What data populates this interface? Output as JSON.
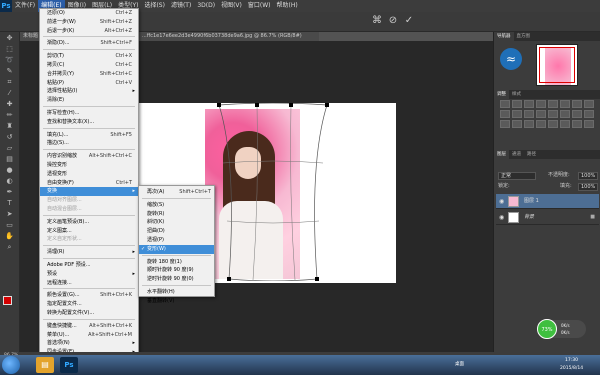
{
  "menubar": {
    "logo": "Ps",
    "items": [
      "文件(F)",
      "编辑(E)",
      "图像(I)",
      "图层(L)",
      "类型(Y)",
      "选择(S)",
      "滤镜(T)",
      "3D(D)",
      "视图(V)",
      "窗口(W)",
      "帮助(H)"
    ],
    "active_index": 1
  },
  "doc_tabs": [
    "未标题",
    "...ffc1e17e6ee2d3e4990f6b03738de9a6.jpg @ 86.7% (RGB/8#)"
  ],
  "edit_menu": {
    "items": [
      {
        "label": "还原(O)",
        "shortcut": "Ctrl+Z"
      },
      {
        "label": "前进一步(W)",
        "shortcut": "Shift+Ctrl+Z"
      },
      {
        "label": "后退一步(K)",
        "shortcut": "Alt+Ctrl+Z"
      },
      {
        "sep": true
      },
      {
        "label": "渐隐(D)...",
        "shortcut": "Shift+Ctrl+F"
      },
      {
        "sep": true
      },
      {
        "label": "剪切(T)",
        "shortcut": "Ctrl+X"
      },
      {
        "label": "拷贝(C)",
        "shortcut": "Ctrl+C"
      },
      {
        "label": "合并拷贝(Y)",
        "shortcut": "Shift+Ctrl+C"
      },
      {
        "label": "粘贴(P)",
        "shortcut": "Ctrl+V"
      },
      {
        "label": "选择性粘贴(I)",
        "shortcut": "",
        "submenu": true
      },
      {
        "label": "清除(E)",
        "shortcut": ""
      },
      {
        "sep": true
      },
      {
        "label": "拼写检查(H)...",
        "shortcut": ""
      },
      {
        "label": "查找和替换文本(X)...",
        "shortcut": ""
      },
      {
        "sep": true
      },
      {
        "label": "填充(L)...",
        "shortcut": "Shift+F5"
      },
      {
        "label": "描边(S)...",
        "shortcut": ""
      },
      {
        "sep": true
      },
      {
        "label": "内容识别缩放",
        "shortcut": "Alt+Shift+Ctrl+C"
      },
      {
        "label": "操控变形",
        "shortcut": ""
      },
      {
        "label": "透视变形",
        "shortcut": ""
      },
      {
        "label": "自由变换(F)",
        "shortcut": "Ctrl+T"
      },
      {
        "label": "变换",
        "shortcut": "",
        "submenu": true,
        "highlight": true
      },
      {
        "label": "自动对齐图层...",
        "shortcut": "",
        "disabled": true
      },
      {
        "label": "自动混合图层...",
        "shortcut": "",
        "disabled": true
      },
      {
        "sep": true
      },
      {
        "label": "定义画笔预设(B)...",
        "shortcut": ""
      },
      {
        "label": "定义图案...",
        "shortcut": ""
      },
      {
        "label": "定义自定形状...",
        "shortcut": "",
        "disabled": true
      },
      {
        "sep": true
      },
      {
        "label": "清理(R)",
        "shortcut": "",
        "submenu": true
      },
      {
        "sep": true
      },
      {
        "label": "Adobe PDF 预设...",
        "shortcut": ""
      },
      {
        "label": "预设",
        "shortcut": "",
        "submenu": true
      },
      {
        "label": "远程连接...",
        "shortcut": ""
      },
      {
        "sep": true
      },
      {
        "label": "颜色设置(G)...",
        "shortcut": "Shift+Ctrl+K"
      },
      {
        "label": "指定配置文件...",
        "shortcut": ""
      },
      {
        "label": "转换为配置文件(V)...",
        "shortcut": ""
      },
      {
        "sep": true
      },
      {
        "label": "键盘快捷键...",
        "shortcut": "Alt+Shift+Ctrl+K"
      },
      {
        "label": "菜单(U)...",
        "shortcut": "Alt+Shift+Ctrl+M"
      },
      {
        "label": "首选项(N)",
        "shortcut": "",
        "submenu": true
      },
      {
        "label": "同步设置(E)",
        "shortcut": "",
        "submenu": true
      }
    ]
  },
  "transform_submenu": {
    "items": [
      {
        "label": "再次(A)",
        "shortcut": "Shift+Ctrl+T"
      },
      {
        "sep": true
      },
      {
        "label": "缩放(S)",
        "shortcut": ""
      },
      {
        "label": "旋转(R)",
        "shortcut": ""
      },
      {
        "label": "斜切(K)",
        "shortcut": ""
      },
      {
        "label": "扭曲(D)",
        "shortcut": ""
      },
      {
        "label": "透视(P)",
        "shortcut": ""
      },
      {
        "label": "变形(W)",
        "shortcut": "",
        "checked": true,
        "highlight": true
      },
      {
        "sep": true
      },
      {
        "label": "旋转 180 度(1)",
        "shortcut": ""
      },
      {
        "label": "顺时针旋转 90 度(9)",
        "shortcut": ""
      },
      {
        "label": "逆时针旋转 90 度(0)",
        "shortcut": ""
      },
      {
        "sep": true
      },
      {
        "label": "水平翻转(H)",
        "shortcut": ""
      },
      {
        "label": "垂直翻转(V)",
        "shortcut": ""
      }
    ]
  },
  "panels": {
    "navigator_tabs": [
      "导航器",
      "直方图"
    ],
    "adjust_tabs": [
      "调整",
      "样式"
    ],
    "layers_tabs": [
      "图层",
      "通道",
      "路径"
    ],
    "blend_mode": "正常",
    "opacity_label": "不透明度:",
    "opacity_value": "100%",
    "lock_label": "锁定:",
    "fill_label": "填充:",
    "fill_value": "100%",
    "layers": [
      {
        "name": "图层 1",
        "selected": true
      },
      {
        "name": "背景",
        "selected": false,
        "locked": true
      }
    ]
  },
  "net_widget": {
    "percent": "73%",
    "up": "0K/s",
    "down": "0K/s"
  },
  "statusbar": {
    "zoom": "86.7%"
  },
  "taskbar": {
    "desktop_label": "桌面",
    "time": "17:30",
    "date": "2015/8/14"
  },
  "colors": {
    "foreground": "#d40000",
    "background": "#000000",
    "menu_highlight": "#3f8ed8",
    "layer_selected": "#4d6e94"
  },
  "icons": {
    "tools": [
      "move-icon",
      "marquee-icon",
      "lasso-icon",
      "quick-select-icon",
      "crop-icon",
      "eyedropper-icon",
      "healing-icon",
      "brush-icon",
      "stamp-icon",
      "history-brush-icon",
      "eraser-icon",
      "gradient-icon",
      "blur-icon",
      "dodge-icon",
      "pen-icon",
      "type-icon",
      "path-select-icon",
      "shape-icon",
      "hand-icon",
      "zoom-icon"
    ]
  }
}
